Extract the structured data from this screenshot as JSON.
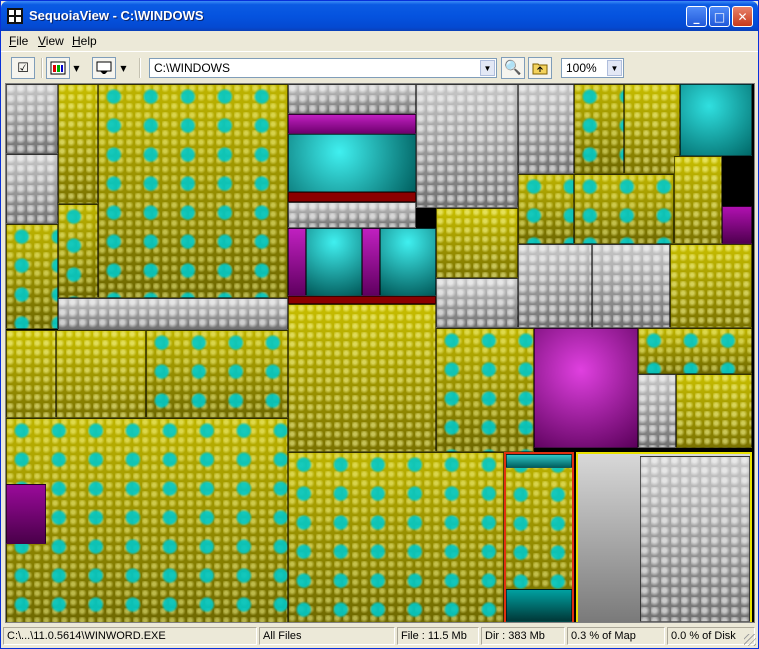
{
  "window": {
    "title": "SequoiaView - C:\\WINDOWS"
  },
  "title_buttons": {
    "minimize": "_",
    "maximize": "□",
    "close": "✕"
  },
  "menu": {
    "items": [
      {
        "label": "File",
        "accel": "F"
      },
      {
        "label": "View",
        "accel": "V"
      },
      {
        "label": "Help",
        "accel": "H"
      }
    ]
  },
  "toolbar": {
    "path": "C:\\WINDOWS",
    "zoom": "100%",
    "icons": [
      "options-icon",
      "color-scheme-icon",
      "filter-icon",
      "zoom-in-icon",
      "folder-up-icon"
    ]
  },
  "treemap": {
    "colors": {
      "yellow": "#B4AA00",
      "gray": "#A0A0A0",
      "cyan": "#00B4B4",
      "magenta": "#B400B4",
      "darkred": "#8B0000"
    }
  },
  "status": {
    "path": "C:\\...\\11.0.5614\\WINWORD.EXE",
    "filter": "All Files",
    "file": "File : 11.5 Mb",
    "dir": "Dir : 383 Mb",
    "map_pct": "0.3 % of Map",
    "disk_pct": "0.0 % of Disk"
  }
}
